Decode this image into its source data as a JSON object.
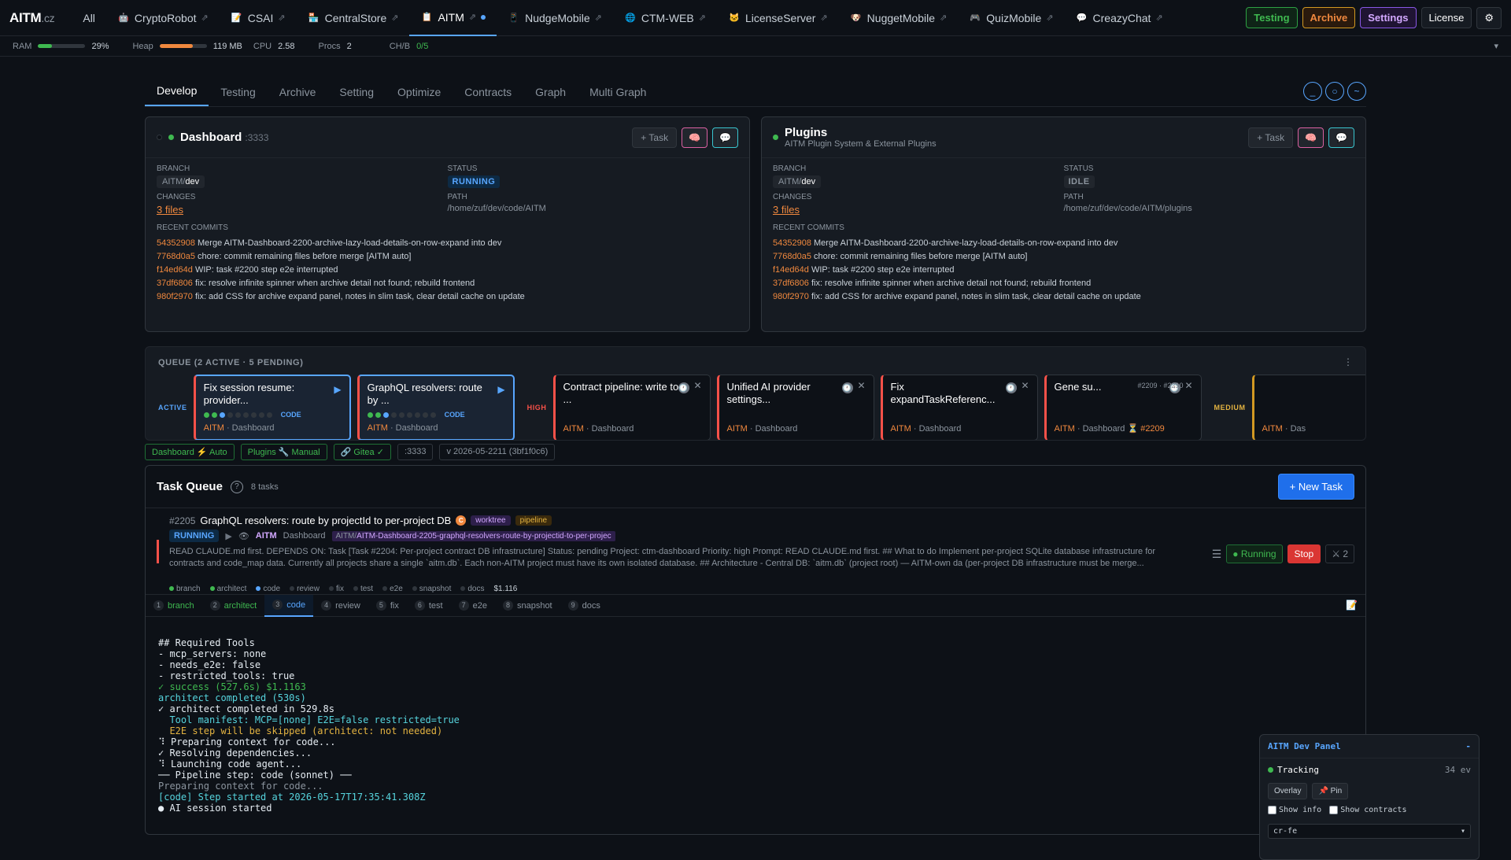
{
  "brand": {
    "name": "AITM",
    "domain": ".cz"
  },
  "nav": {
    "all": "All",
    "tabs": [
      {
        "label": "CryptoRobot",
        "icon": "robot-icon"
      },
      {
        "label": "CSAI",
        "icon": "memo-icon"
      },
      {
        "label": "CentralStore",
        "icon": "store-icon"
      },
      {
        "label": "AITM",
        "icon": "clipboard-icon",
        "active": true
      },
      {
        "label": "NudgeMobile",
        "icon": "phone-icon"
      },
      {
        "label": "CTM-WEB",
        "icon": "globe-icon"
      },
      {
        "label": "LicenseServer",
        "icon": "cat-icon"
      },
      {
        "label": "NuggetMobile",
        "icon": "dog-icon"
      },
      {
        "label": "QuizMobile",
        "icon": "gamepad-icon"
      },
      {
        "label": "CreazyChat",
        "icon": "chat-icon"
      }
    ],
    "buttons": {
      "testing": "Testing",
      "archive": "Archive",
      "settings": "Settings",
      "license": "License"
    }
  },
  "stats": {
    "ram_label": "RAM",
    "ram_value": "29%",
    "ram_fraction": 0.29,
    "heap_label": "Heap",
    "heap_value": "119 MB",
    "heap_fraction": 0.7,
    "cpu_label": "CPU",
    "cpu_value": "2.58",
    "procs_label": "Procs",
    "procs_value": "2",
    "chb_label": "CH/B",
    "chb_value": "0/5"
  },
  "subtabs": [
    "Develop",
    "Testing",
    "Archive",
    "Setting",
    "Optimize",
    "Contracts",
    "Graph",
    "Multi Graph"
  ],
  "circle_icons": [
    "_",
    "○",
    "~"
  ],
  "cards": [
    {
      "title": "Dashboard",
      "port": ":3333",
      "subtitle": "",
      "task_btn": "+ Task",
      "branch_label": "BRANCH",
      "branch_prefix": "AITM/",
      "branch": "dev",
      "status_label": "STATUS",
      "status": "RUNNING",
      "changes_label": "CHANGES",
      "changes": "3 files",
      "path_label": "PATH",
      "path": "/home/zuf/dev/code/AITM",
      "commits_label": "RECENT COMMITS",
      "commits": [
        [
          "54352908",
          "Merge AITM-Dashboard-2200-archive-lazy-load-details-on-row-expand into dev"
        ],
        [
          "7768d0a5",
          "chore: commit remaining files before merge [AITM auto]"
        ],
        [
          "f14ed64d",
          "WIP: task #2200 step e2e interrupted"
        ],
        [
          "37df6806",
          "fix: resolve infinite spinner when archive detail not found; rebuild frontend"
        ],
        [
          "980f2970",
          "fix: add CSS for archive expand panel, notes in slim task, clear detail cache on update"
        ]
      ]
    },
    {
      "title": "Plugins",
      "port": "",
      "subtitle": "AITM Plugin System & External Plugins",
      "task_btn": "+ Task",
      "branch_label": "BRANCH",
      "branch_prefix": "AITM/",
      "branch": "dev",
      "status_label": "STATUS",
      "status": "IDLE",
      "changes_label": "CHANGES",
      "changes": "3 files",
      "path_label": "PATH",
      "path": "/home/zuf/dev/code/AITM/plugins",
      "commits_label": "RECENT COMMITS",
      "commits": [
        [
          "54352908",
          "Merge AITM-Dashboard-2200-archive-lazy-load-details-on-row-expand into dev"
        ],
        [
          "7768d0a5",
          "chore: commit remaining files before merge [AITM auto]"
        ],
        [
          "f14ed64d",
          "WIP: task #2200 step e2e interrupted"
        ],
        [
          "37df6806",
          "fix: resolve infinite spinner when archive detail not found; rebuild frontend"
        ],
        [
          "980f2970",
          "fix: add CSS for archive expand panel, notes in slim task, clear detail cache on update"
        ]
      ]
    }
  ],
  "queue": {
    "title": "QUEUE (2 ACTIVE · 5 PENDING)",
    "lanes": {
      "active": "ACTIVE",
      "high": "HIGH",
      "medium": "MEDIUM"
    },
    "code_tag": "CODE",
    "active": [
      {
        "title": "Fix session resume: provider...",
        "project": "AITM",
        "sub": "Dashboard"
      },
      {
        "title": "GraphQL resolvers: route by ...",
        "project": "AITM",
        "sub": "Dashboard"
      }
    ],
    "high": [
      {
        "title": "Contract pipeline: write to ...",
        "project": "AITM",
        "sub": "Dashboard"
      },
      {
        "title": "Unified AI provider settings...",
        "project": "AITM",
        "sub": "Dashboard"
      },
      {
        "title": "Fix expandTaskReferenc...",
        "project": "AITM",
        "sub": "Dashboard"
      },
      {
        "title": "Gene su...",
        "project": "AITM",
        "sub": "Dashboard",
        "deps": "#2209 · #2210",
        "wait": "⏳ #2209"
      }
    ],
    "medium": [
      {
        "title": "",
        "project": "AITM",
        "sub": "Das"
      }
    ]
  },
  "chips": [
    "Dashboard ⚡ Auto",
    "Plugins 🔧 Manual",
    "🔗 Gitea ✓",
    ":3333",
    "v 2026-05-2211 (3bf1f0c6)"
  ],
  "taskqueue": {
    "title": "Task Queue",
    "help": "?",
    "count": "8 tasks",
    "new_btn": "+ New Task",
    "task": {
      "id": "#2205",
      "name": "GraphQL resolvers: route by projectId to per-project DB",
      "c": "C",
      "tags": [
        "worktree",
        "pipeline"
      ],
      "status": "RUNNING",
      "project": "AITM",
      "sub": "Dashboard",
      "branch_prefix": "AITM/",
      "branch": "AITM-Dashboard-2205-graphql-resolvers-route-by-projectid-to-per-projec",
      "prompt": "READ CLAUDE.md first. DEPENDS ON: Task [Task #2204: Per-project contract DB infrastructure] Status: pending Project: ctm-dashboard Priority: high Prompt: READ CLAUDE.md first. ## What to do Implement per-project SQLite database infrastructure for contracts and code_map data. Currently all projects share a single `aitm.db`. Each non-AITM project must have its own isolated database. ## Architecture - Central DB: `aitm.db` (project root) — AITM-own da (per-project DB infrastructure must be merge...",
      "steps": [
        "branch",
        "architect",
        "code",
        "review",
        "fix",
        "test",
        "e2e",
        "snapshot",
        "docs"
      ],
      "cost": "$1.116",
      "running": "Running",
      "stop": "Stop",
      "x": "⚔ 2"
    }
  },
  "steptabs": [
    {
      "n": "1",
      "label": "branch"
    },
    {
      "n": "2",
      "label": "architect"
    },
    {
      "n": "3",
      "label": "code"
    },
    {
      "n": "4",
      "label": "review"
    },
    {
      "n": "5",
      "label": "fix"
    },
    {
      "n": "6",
      "label": "test"
    },
    {
      "n": "7",
      "label": "e2e"
    },
    {
      "n": "8",
      "label": "snapshot"
    },
    {
      "n": "9",
      "label": "docs"
    }
  ],
  "log": [
    [
      "w",
      "## Required Tools"
    ],
    [
      "w",
      "- mcp_servers: none"
    ],
    [
      "w",
      "- needs_e2e: false"
    ],
    [
      "w",
      "- restricted_tools: true"
    ],
    [
      "g",
      "✓ success (527.6s) $1.1163"
    ],
    [
      "c",
      "architect completed (530s)"
    ],
    [
      "w",
      "✓ architect completed in 529.8s"
    ],
    [
      "c",
      "  Tool manifest: MCP=[none] E2E=false restricted=true"
    ],
    [
      "y",
      "  E2E step will be skipped (architect: not needed)"
    ],
    [
      "w",
      "⠹ Preparing context for code..."
    ],
    [
      "w",
      "✓ Resolving dependencies..."
    ],
    [
      "w",
      "⠹ Launching code agent..."
    ],
    [
      "w",
      "── Pipeline step: code (sonnet) ──"
    ],
    [
      "m",
      "Preparing context for code..."
    ],
    [
      "c",
      "[code] Step started at 2026-05-17T17:35:41.308Z"
    ],
    [
      "w",
      "● AI session started"
    ]
  ],
  "devpanel": {
    "title": "AITM Dev Panel",
    "min": "-",
    "tracking": "Tracking",
    "events": "34 ev",
    "overlay": "Overlay",
    "pin": "📌 Pin",
    "show_info": "Show info",
    "show_contracts": "Show contracts",
    "select": "cr-fe"
  }
}
